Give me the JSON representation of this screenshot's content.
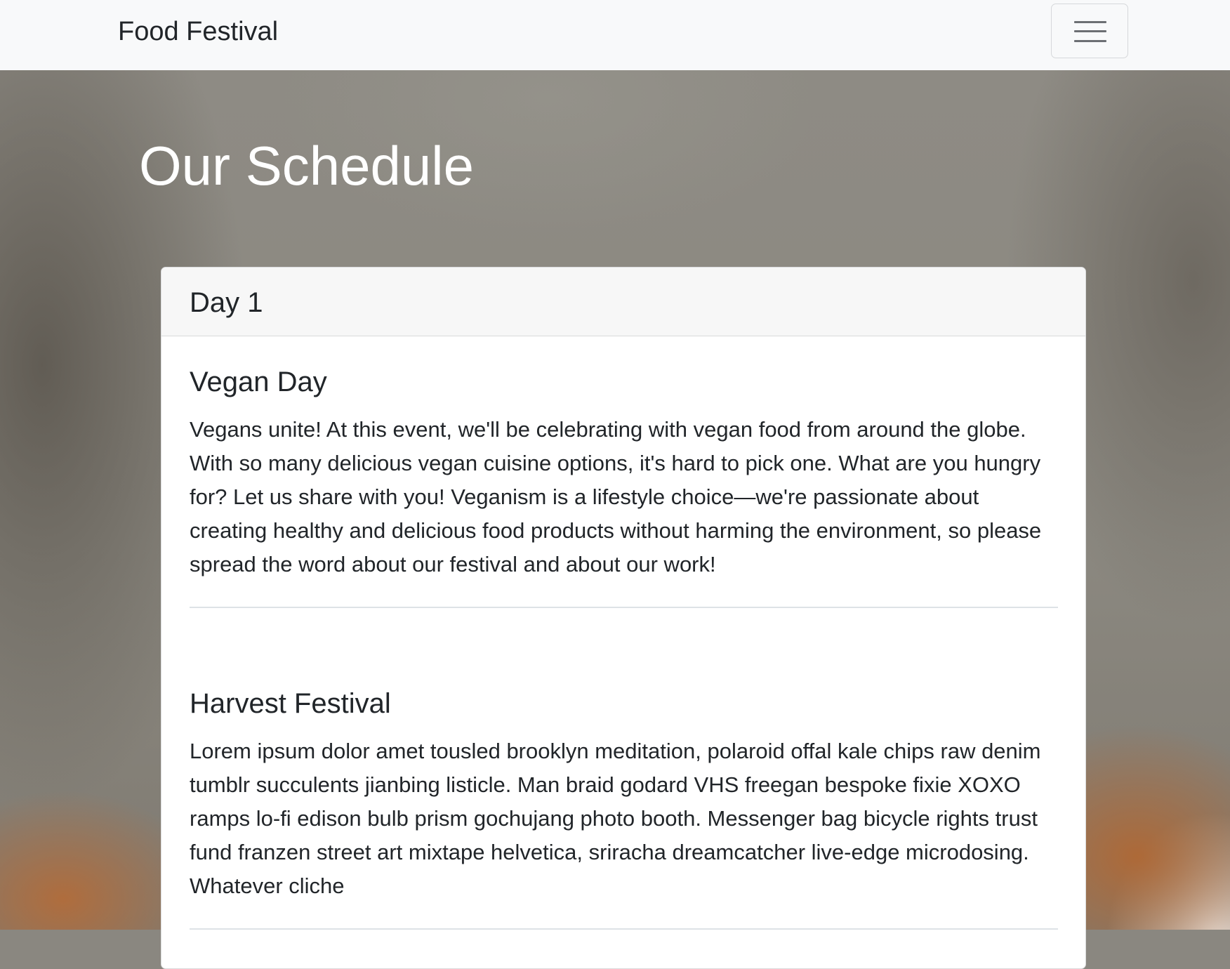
{
  "navbar": {
    "brand": "Food Festival",
    "toggler_icon": "hamburger-icon"
  },
  "page": {
    "title": "Our Schedule"
  },
  "schedule": {
    "day_label": "Day 1",
    "events": [
      {
        "title": "Vegan Day",
        "description": "Vegans unite! At this event, we'll be celebrating with vegan food from around the globe. With so many delicious vegan cuisine options, it's hard to pick one. What are you hungry for? Let us share with you! Veganism is a lifestyle choice—we're passionate about creating healthy and delicious food products without harming the environment, so please spread the word about our festival and about our work!"
      },
      {
        "title": "Harvest Festival",
        "description": "Lorem ipsum dolor amet tousled brooklyn meditation, polaroid offal kale chips raw denim tumblr succulents jianbing listicle. Man braid godard VHS freegan bespoke fixie XOXO ramps lo-fi edison bulb prism gochujang photo booth. Messenger bag bicycle rights trust fund franzen street art mixtape helvetica, sriracha dreamcatcher live-edge microdosing. Whatever cliche"
      }
    ]
  }
}
